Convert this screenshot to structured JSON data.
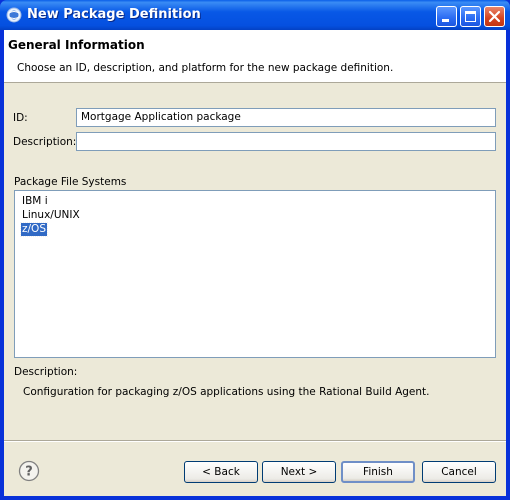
{
  "window": {
    "title": "New Package Definition"
  },
  "header": {
    "title": "General Information",
    "description": "Choose an ID, description, and platform for the new package definition."
  },
  "form": {
    "id_label": "ID:",
    "id_value": "Mortgage Application package",
    "description_label": "Description:",
    "description_value": ""
  },
  "file_systems": {
    "label": "Package File Systems",
    "items": [
      "IBM i",
      "Linux/UNIX",
      "z/OS"
    ],
    "selected": "z/OS"
  },
  "details": {
    "label": "Description:",
    "text": "Configuration for packaging z/OS applications using the Rational Build Agent."
  },
  "buttons": {
    "back": "< Back",
    "next": "Next >",
    "finish": "Finish",
    "cancel": "Cancel"
  },
  "icons": {
    "app": "eclipse-globe-icon",
    "help": "help-question-icon",
    "minimize": "minimize-icon",
    "maximize": "maximize-icon",
    "close": "close-icon"
  }
}
